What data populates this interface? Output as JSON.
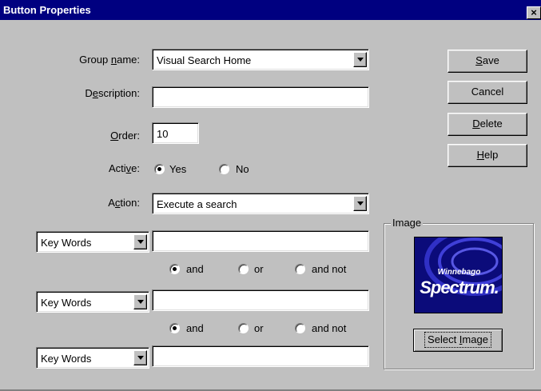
{
  "window": {
    "title": "Button Properties",
    "close_glyph": "×"
  },
  "form": {
    "group_name_label": "Group name:",
    "group_name_value": "Visual Search Home",
    "description_label": "Description:",
    "description_value": "",
    "order_label": "Order:",
    "order_value": "10",
    "active_label": "Active:",
    "active_yes": "Yes",
    "active_no": "No",
    "active_selected": "Yes",
    "action_label": "Action:",
    "action_value": "Execute a search"
  },
  "search_rows": [
    {
      "field": "Key Words",
      "value": ""
    },
    {
      "field": "Key Words",
      "value": ""
    },
    {
      "field": "Key Words",
      "value": ""
    }
  ],
  "operators": [
    {
      "and": "and",
      "or": "or",
      "and_not": "and not",
      "selected": "and"
    },
    {
      "and": "and",
      "or": "or",
      "and_not": "and not",
      "selected": "and"
    }
  ],
  "buttons": {
    "save": "Save",
    "cancel": "Cancel",
    "delete": "Delete",
    "help": "Help"
  },
  "image_group": {
    "title": "Image",
    "logo_small": "Winnebago",
    "logo_big": "Spectrum.",
    "select_button": "Select Image"
  },
  "colors": {
    "titlebar": "#000080",
    "face": "#c0c0c0",
    "logo_bg": "#0b0b7a"
  }
}
